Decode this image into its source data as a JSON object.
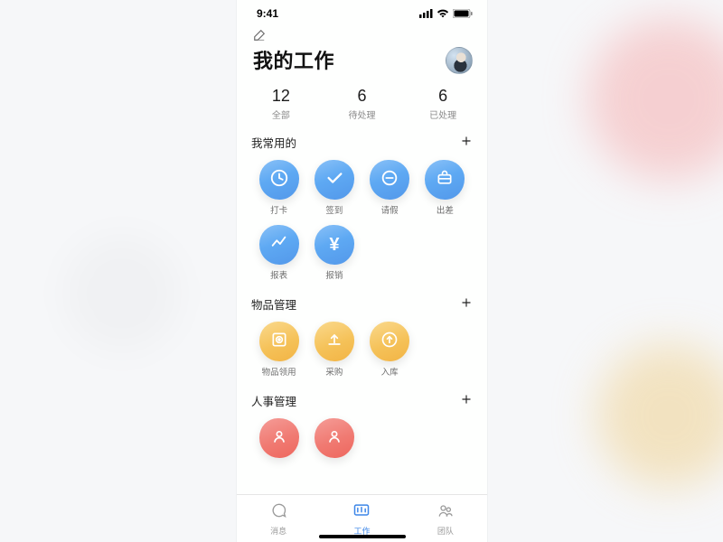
{
  "statusbar": {
    "time": "9:41"
  },
  "header": {
    "title": "我的工作"
  },
  "stats": [
    {
      "value": "12",
      "label": "全部"
    },
    {
      "value": "6",
      "label": "待处理"
    },
    {
      "value": "6",
      "label": "已处理"
    }
  ],
  "sections": {
    "favorites": {
      "title": "我常用的",
      "items": [
        {
          "label": "打卡"
        },
        {
          "label": "签到"
        },
        {
          "label": "请假"
        },
        {
          "label": "出差"
        },
        {
          "label": "报表"
        },
        {
          "label": "报销"
        }
      ]
    },
    "goods": {
      "title": "物品管理",
      "items": [
        {
          "label": "物品领用"
        },
        {
          "label": "采购"
        },
        {
          "label": "入库"
        }
      ]
    },
    "hr": {
      "title": "人事管理"
    }
  },
  "tabs": [
    {
      "label": "消息"
    },
    {
      "label": "工作"
    },
    {
      "label": "团队"
    }
  ]
}
